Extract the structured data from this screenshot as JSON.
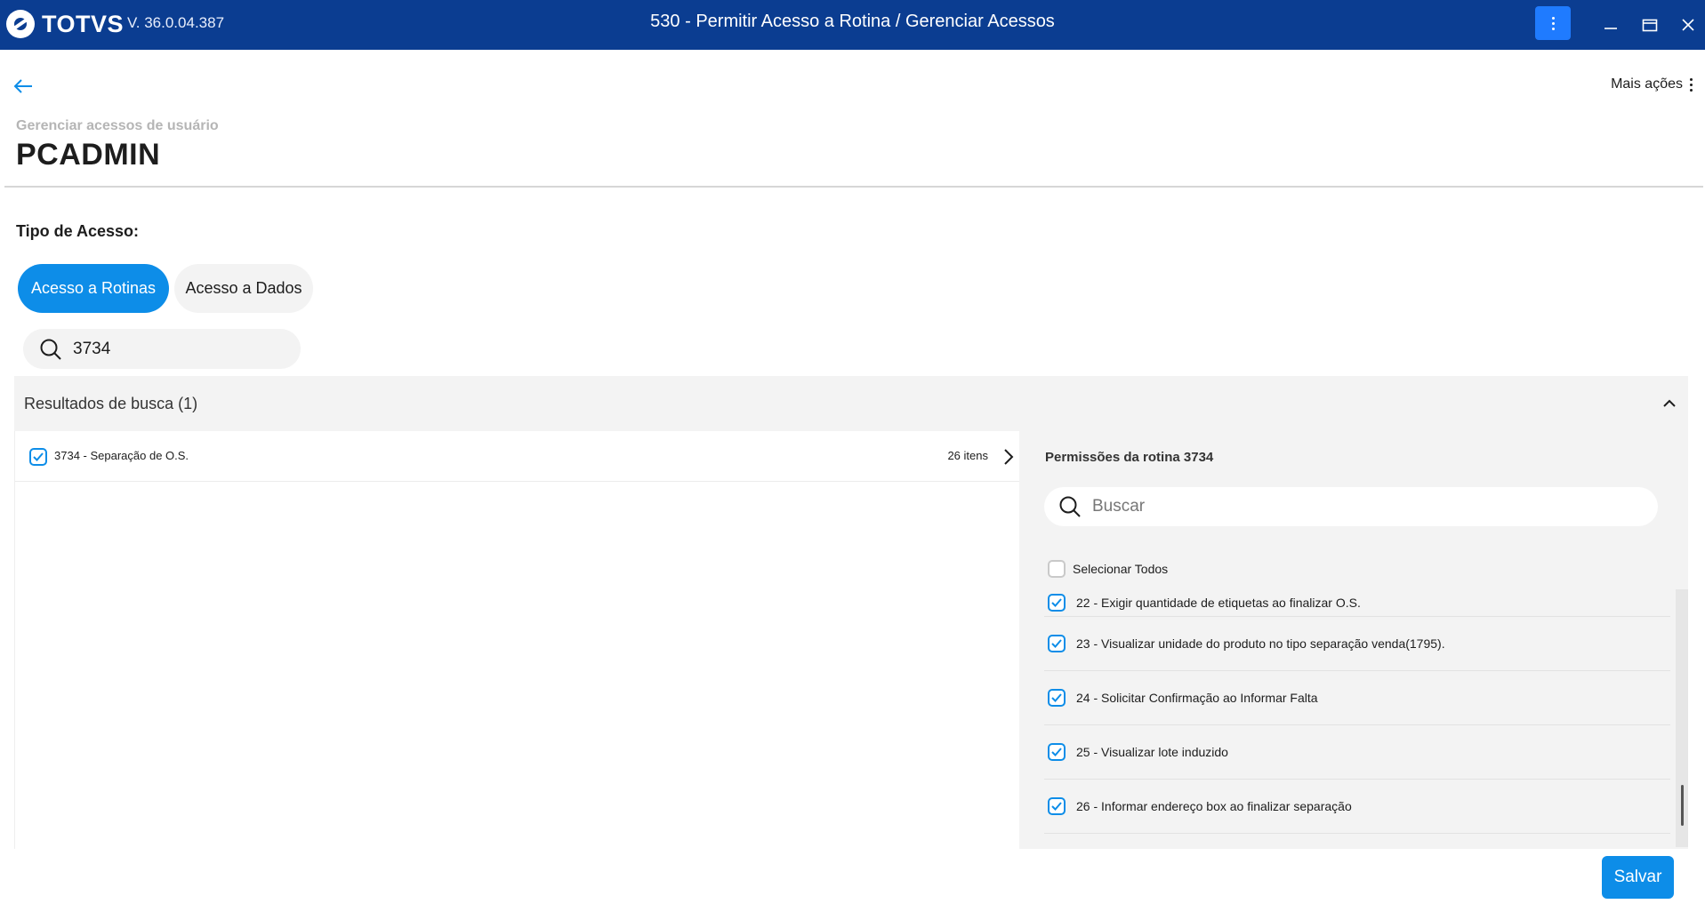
{
  "titlebar": {
    "brand": "TOTVS",
    "version": "V. 36.0.04.387",
    "title": "530 - Permitir Acesso a Rotina / Gerenciar Acessos"
  },
  "header": {
    "more_actions": "Mais ações",
    "subtitle": "Gerenciar acessos de usuário",
    "user": "PCADMIN"
  },
  "access": {
    "label": "Tipo de Acesso:",
    "tabs": [
      {
        "label": "Acesso a Rotinas",
        "active": true
      },
      {
        "label": "Acesso a Dados",
        "active": false
      }
    ]
  },
  "search": {
    "value": "3734"
  },
  "results": {
    "header": "Resultados de busca (1)",
    "items": [
      {
        "name": "3734 - Separação de O.S.",
        "count": "26 itens",
        "checked": true
      }
    ]
  },
  "permissions": {
    "title": "Permissões da rotina 3734",
    "search_placeholder": "Buscar",
    "select_all": "Selecionar Todos",
    "items": [
      {
        "label": "22 - Exigir quantidade de etiquetas ao finalizar O.S.",
        "checked": true
      },
      {
        "label": "23 - Visualizar unidade do produto no tipo separação venda(1795).",
        "checked": true
      },
      {
        "label": "24 - Solicitar Confirmação ao Informar Falta",
        "checked": true
      },
      {
        "label": "25 - Visualizar lote induzido",
        "checked": true
      },
      {
        "label": "26 - Informar endereço box ao finalizar separação",
        "checked": true
      }
    ]
  },
  "footer": {
    "save_label": "Salvar"
  },
  "colors": {
    "titlebar": "#0b3d91",
    "accent": "#0d8de8",
    "panel": "#f3f3f3"
  }
}
